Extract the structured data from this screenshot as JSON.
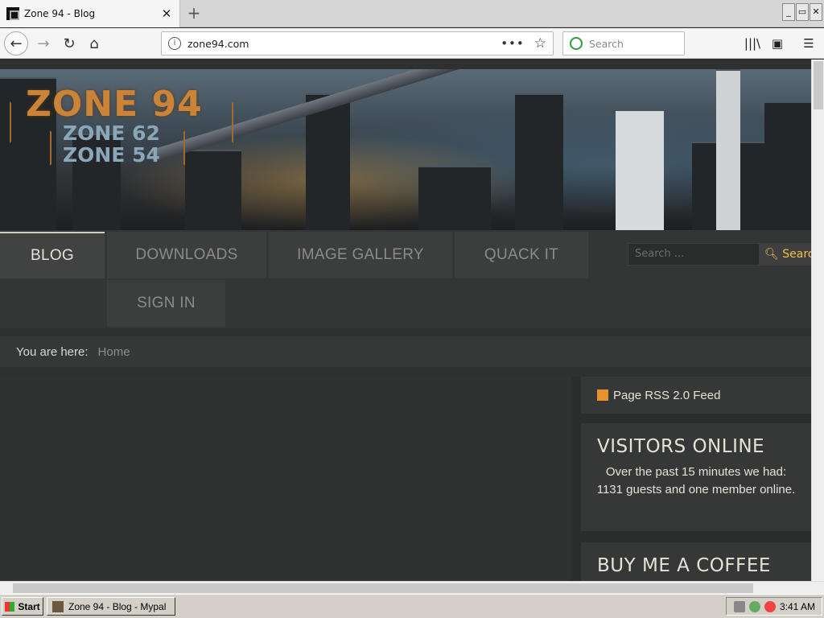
{
  "browser": {
    "tab_title": "Zone 94 - Blog",
    "tab_close": "✕",
    "new_tab": "+",
    "url": "zone94.com",
    "page_actions": "•••",
    "search_placeholder": "Search",
    "window_buttons": [
      "_",
      "▭",
      "✕"
    ]
  },
  "site": {
    "logo": {
      "main": "ZONE 94",
      "sub1": "ZONE 62",
      "sub2": "ZONE 54"
    },
    "menu": [
      {
        "label": "BLOG",
        "active": true
      },
      {
        "label": "DOWNLOADS",
        "active": false
      },
      {
        "label": "IMAGE GALLERY",
        "active": false
      },
      {
        "label": "QUACK IT",
        "active": false
      },
      {
        "label": "SIGN IN",
        "active": false
      }
    ],
    "search": {
      "placeholder": "Search ...",
      "button": "Search"
    },
    "breadcrumb": {
      "label": "You are here:",
      "current": "Home"
    },
    "sidebar": {
      "rss": "Page RSS 2.0 Feed",
      "visitors_title": "VISITORS ONLINE",
      "visitors_text": "Over the past 15 minutes we had: 1131 guests and one member online.",
      "coffee_title": "BUY ME A COFFEE"
    }
  },
  "taskbar": {
    "start": "Start",
    "window": "Zone 94 - Blog - Mypal",
    "clock": "3:41 AM"
  }
}
